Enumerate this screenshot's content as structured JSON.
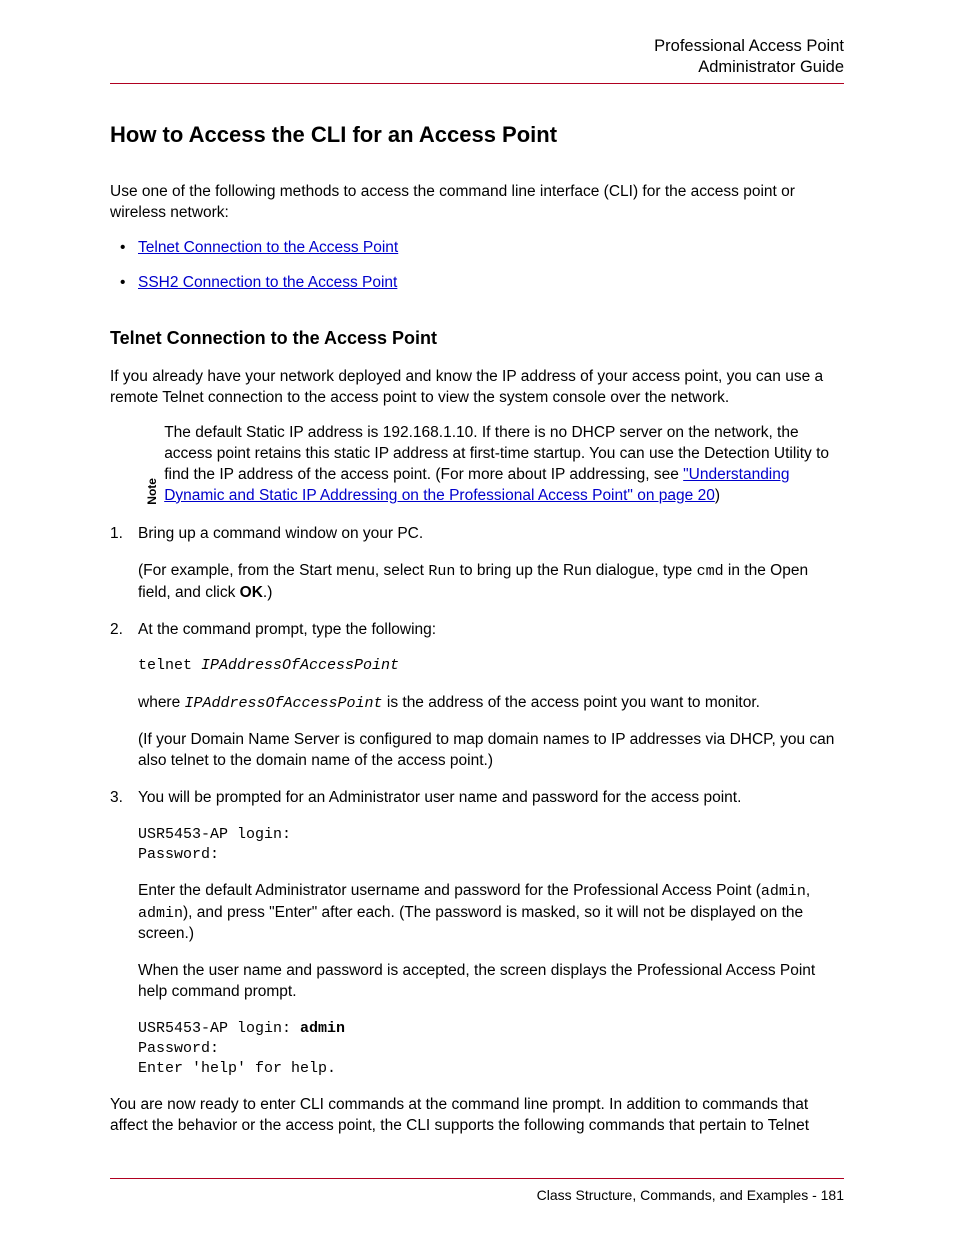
{
  "header": {
    "line1": "Professional Access Point",
    "line2": "Administrator Guide"
  },
  "title": "How to Access the CLI for an Access Point",
  "intro": "Use one of the following methods to access the command line interface (CLI) for the access point or wireless network:",
  "links": {
    "telnet": "Telnet Connection to the Access Point",
    "ssh2": "SSH2 Connection to the Access Point"
  },
  "section_heading": "Telnet Connection to the Access Point",
  "section_para": "If you already have your network deployed and know the IP address of your access point, you can use a remote Telnet connection to the access point to view the system console over the network.",
  "note": {
    "label": "Note",
    "part1": "The default Static IP address is 192.168.1.10. If there is no DHCP server on the network, the access point retains this static IP address at first-time startup. You can use the Detection Utility to find the IP address of the access point. (For more about IP addressing, see ",
    "link": "\"Understanding Dynamic and Static IP Addressing on the Professional Access Point\" on page 20",
    "part2": ")"
  },
  "steps": {
    "s1": {
      "main": "Bring up a command window on your PC.",
      "sub_a": "(For example, from the Start menu, select ",
      "run": "Run",
      "sub_b": " to bring up the Run dialogue, type ",
      "cmd": "cmd",
      "sub_c": " in the Open field, and click ",
      "ok": "OK",
      "sub_d": ".)"
    },
    "s2": {
      "main": "At the command prompt, type the following:",
      "code_a": "telnet ",
      "code_b": "IPAddressOfAccessPoint",
      "where_a": "where ",
      "where_var": "IPAddressOfAccessPoint",
      "where_b": " is the address of the access point you want to monitor.",
      "dns": "(If your Domain Name Server is configured to map domain names to IP addresses via DHCP, you can also telnet to the domain name of the access point.)"
    },
    "s3": {
      "main": "You will be prompted for an Administrator user name and password for the access point.",
      "code1": "USR5453-AP login:\nPassword:",
      "enter_a": "Enter the default Administrator username and password for the Professional Access Point (",
      "admin1": "admin",
      "enter_b": ", ",
      "admin2": "admin",
      "enter_c": "), and press \"Enter\" after each. (The password is masked, so it will not be displayed on the screen.)",
      "accepted": "When the user name and password is accepted, the screen displays the Professional Access Point help command prompt.",
      "code2_a": "USR5453-AP login: ",
      "code2_admin": "admin",
      "code2_b": "\nPassword:\nEnter 'help' for help."
    }
  },
  "closing": "You are now ready to enter CLI commands at the command line prompt. In addition to commands that affect the behavior or the access point, the CLI supports the following commands that pertain to Telnet",
  "footer": {
    "text": "Class Structure, Commands, and Examples - 181"
  }
}
